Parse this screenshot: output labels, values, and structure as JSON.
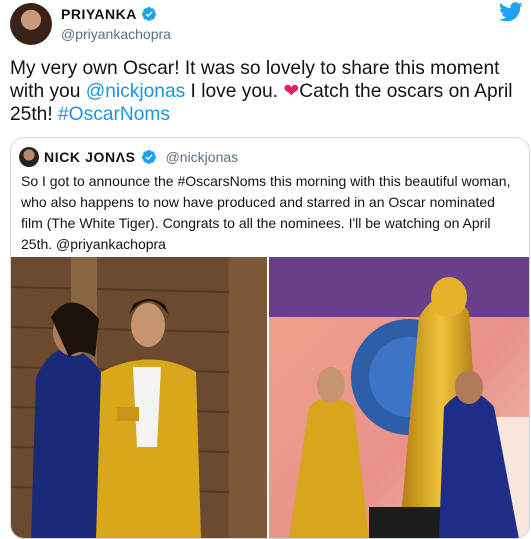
{
  "tweet": {
    "display_name": "PRIYANKA",
    "handle": "@priyankachopra",
    "text_part1": "My very own Oscar! It was so lovely to share this moment with you ",
    "mention": "@nickjonas",
    "text_part2": " I love you. ",
    "heart": "❤",
    "text_part3": "Catch the oscars on April 25th! ",
    "hashtag": "#OscarNoms"
  },
  "quoted_tweet": {
    "display_name": "NICK JONΛS",
    "handle": "@nickjonas",
    "text": "So I got to announce the #OscarsNoms this morning with this beautiful woman, who also happens to now have produced and starred in an Oscar nominated film (The White Tiger). Congrats to all the nominees. I'll be watching on April 25th. @priyankachopra"
  },
  "icons": {
    "verified": "verified-badge-icon",
    "twitter": "twitter-bird-icon"
  },
  "colors": {
    "link": "#1b95e0",
    "verified": "#1da1f2",
    "heart": "#e0245e",
    "secondary_text": "#5b7083",
    "border": "#cfd9de"
  }
}
